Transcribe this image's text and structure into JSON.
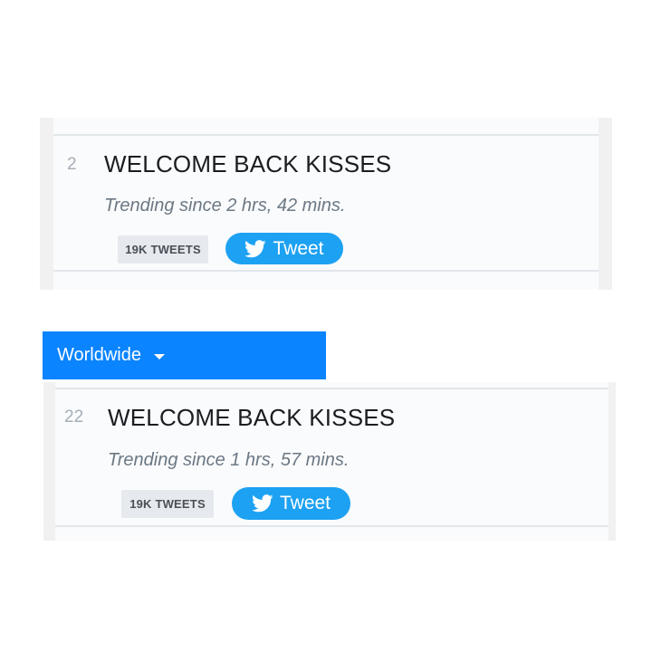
{
  "screens": [
    {
      "trend": {
        "rank": "2",
        "name": "WELCOME BACK KISSES",
        "since": "Trending since 2 hrs, 42 mins.",
        "tweet_count": "19K TWEETS",
        "tweet_button": "Tweet"
      }
    },
    {
      "region": {
        "label": "Worldwide",
        "accent_color": "#0a84ff"
      },
      "trend": {
        "rank": "22",
        "name": "WELCOME BACK KISSES",
        "since": "Trending since 1 hrs, 57 mins.",
        "tweet_count": "19K TWEETS",
        "tweet_button": "Tweet"
      }
    }
  ],
  "icons": {
    "tweet_button": "twitter-bird-icon",
    "dropdown": "caret-down-icon"
  },
  "colors": {
    "twitter_blue": "#1da1f2"
  }
}
